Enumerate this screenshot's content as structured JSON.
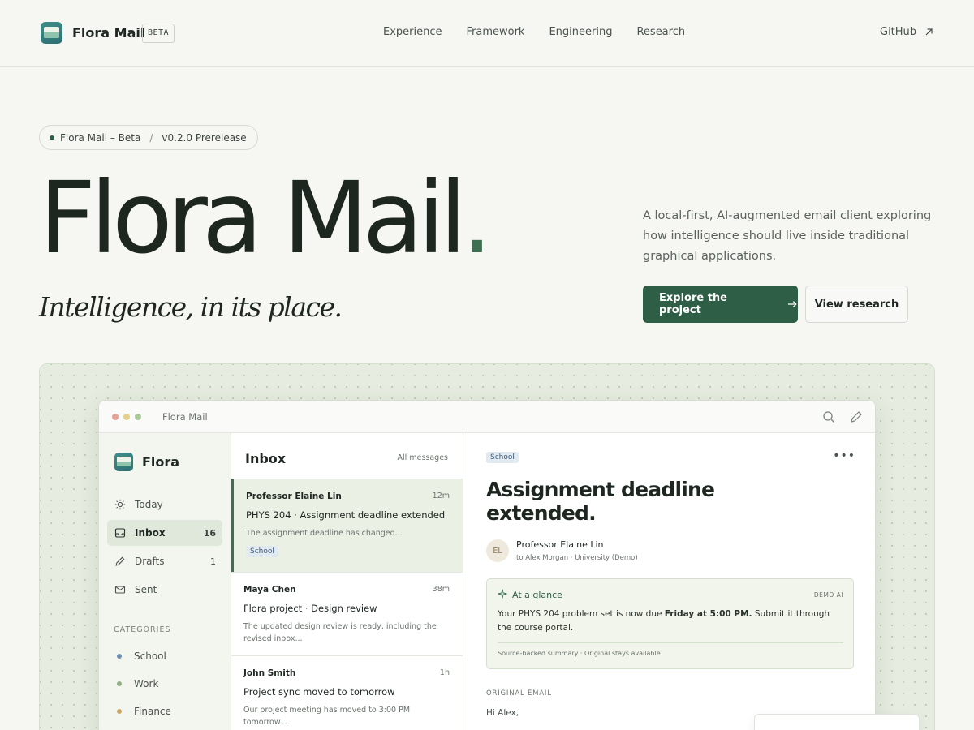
{
  "topbar": {
    "brand": "Flora Mail",
    "badge": "BETA",
    "nav": [
      "Experience",
      "Framework",
      "Engineering",
      "Research"
    ],
    "github": "GitHub",
    "github_icon": "arrow-up-right-icon"
  },
  "hero": {
    "pill_product": "Flora Mail – Beta",
    "pill_separator": "/",
    "pill_version": "v0.2.0 Prerelease",
    "title": "Flora Mail",
    "title_dot": ".",
    "subtitle": "Intelligence, in its place.",
    "description": "A local-first, AI-augmented email client exploring how intelligence should live inside traditional graphical applications.",
    "primary_button": "Explore the project",
    "primary_button_icon": "arrow-right-icon",
    "secondary_button": "View research"
  },
  "app": {
    "window_title": "Flora Mail",
    "sidebar": {
      "brand": "Flora",
      "items": [
        {
          "label": "Today",
          "count": "",
          "icon": "sun-icon"
        },
        {
          "label": "Inbox",
          "count": "16",
          "icon": "inbox-icon"
        },
        {
          "label": "Drafts",
          "count": "1",
          "icon": "pencil-icon"
        },
        {
          "label": "Sent",
          "count": "",
          "icon": "envelope-icon"
        }
      ],
      "categories_heading": "CATEGORIES",
      "categories": [
        {
          "label": "School",
          "color": "#6f8fb3"
        },
        {
          "label": "Work",
          "color": "#8fae84"
        },
        {
          "label": "Finance",
          "color": "#c9a764"
        }
      ]
    },
    "list": {
      "title": "Inbox",
      "filter": "All messages",
      "messages": [
        {
          "from": "Professor Elaine Lin",
          "time": "12m",
          "subject": "PHYS 204 · Assignment deadline extended",
          "preview": "The assignment deadline has changed...",
          "tag": "School"
        },
        {
          "from": "Maya Chen",
          "time": "38m",
          "subject": "Flora project · Design review",
          "preview": "The updated design review is ready, including the revised inbox...",
          "tag": ""
        },
        {
          "from": "John Smith",
          "time": "1h",
          "subject": "Project sync moved to tomorrow",
          "preview": "Our project meeting has moved to 3:00 PM tomorrow...",
          "tag": ""
        }
      ]
    },
    "reader": {
      "tag": "School",
      "title": "Assignment deadline extended.",
      "avatar_initials": "EL",
      "from": "Professor Elaine Lin",
      "to": "to Alex Morgan · University (Demo)",
      "glance": {
        "title": "At a glance",
        "badge": "DEMO AI",
        "body_pre": "Your PHYS 204 problem set is now due ",
        "body_bold": "Friday at 5:00 PM.",
        "body_post": " Submit it through the course portal.",
        "footer": "Source-backed summary · Original stays available"
      },
      "original_heading": "ORIGINAL EMAIL",
      "greeting": "Hi Alex,"
    }
  },
  "colors": {
    "accent": "#2f5e46",
    "background": "#f6f6f3",
    "showcase_bg": "#e6ede0"
  }
}
